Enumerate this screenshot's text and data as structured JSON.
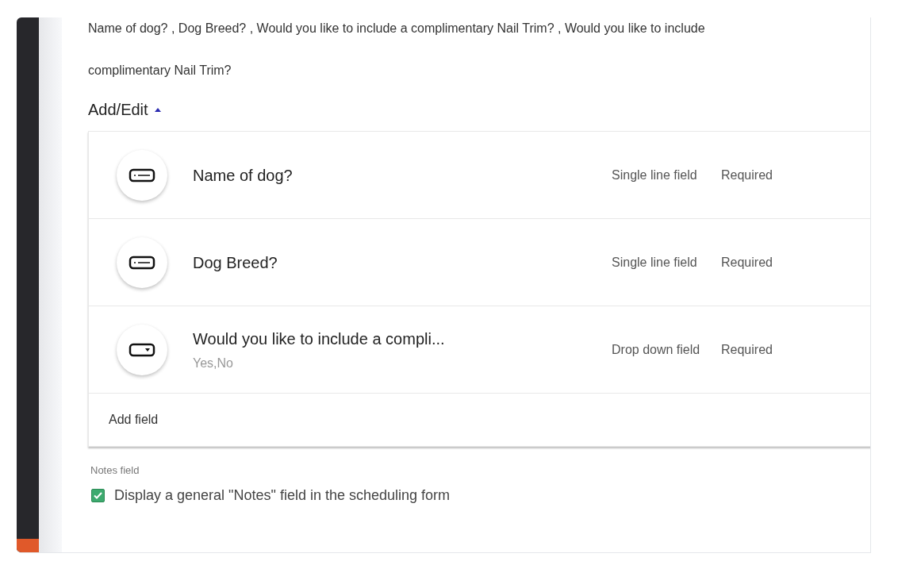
{
  "summary_lines": [
    "Name of dog? , Dog Breed? , Would you like to include a complimentary Nail Trim? , Would you like to include",
    "complimentary Nail Trim?"
  ],
  "section": {
    "label": "Add/Edit",
    "expanded": true
  },
  "fields": [
    {
      "kind": "single",
      "name": "Name of dog?",
      "type": "Single line field",
      "required": "Required"
    },
    {
      "kind": "single",
      "name": "Dog Breed?",
      "type": "Single line field",
      "required": "Required"
    },
    {
      "kind": "dropdown",
      "name": "Would you like to include a compli...",
      "options": "Yes,No",
      "type": "Drop down field",
      "required": "Required"
    }
  ],
  "add_field": "Add field",
  "notes": {
    "label": "Notes field",
    "checkbox": {
      "label": "Display a general \"Notes\" field in the scheduling form",
      "checked": true
    }
  }
}
